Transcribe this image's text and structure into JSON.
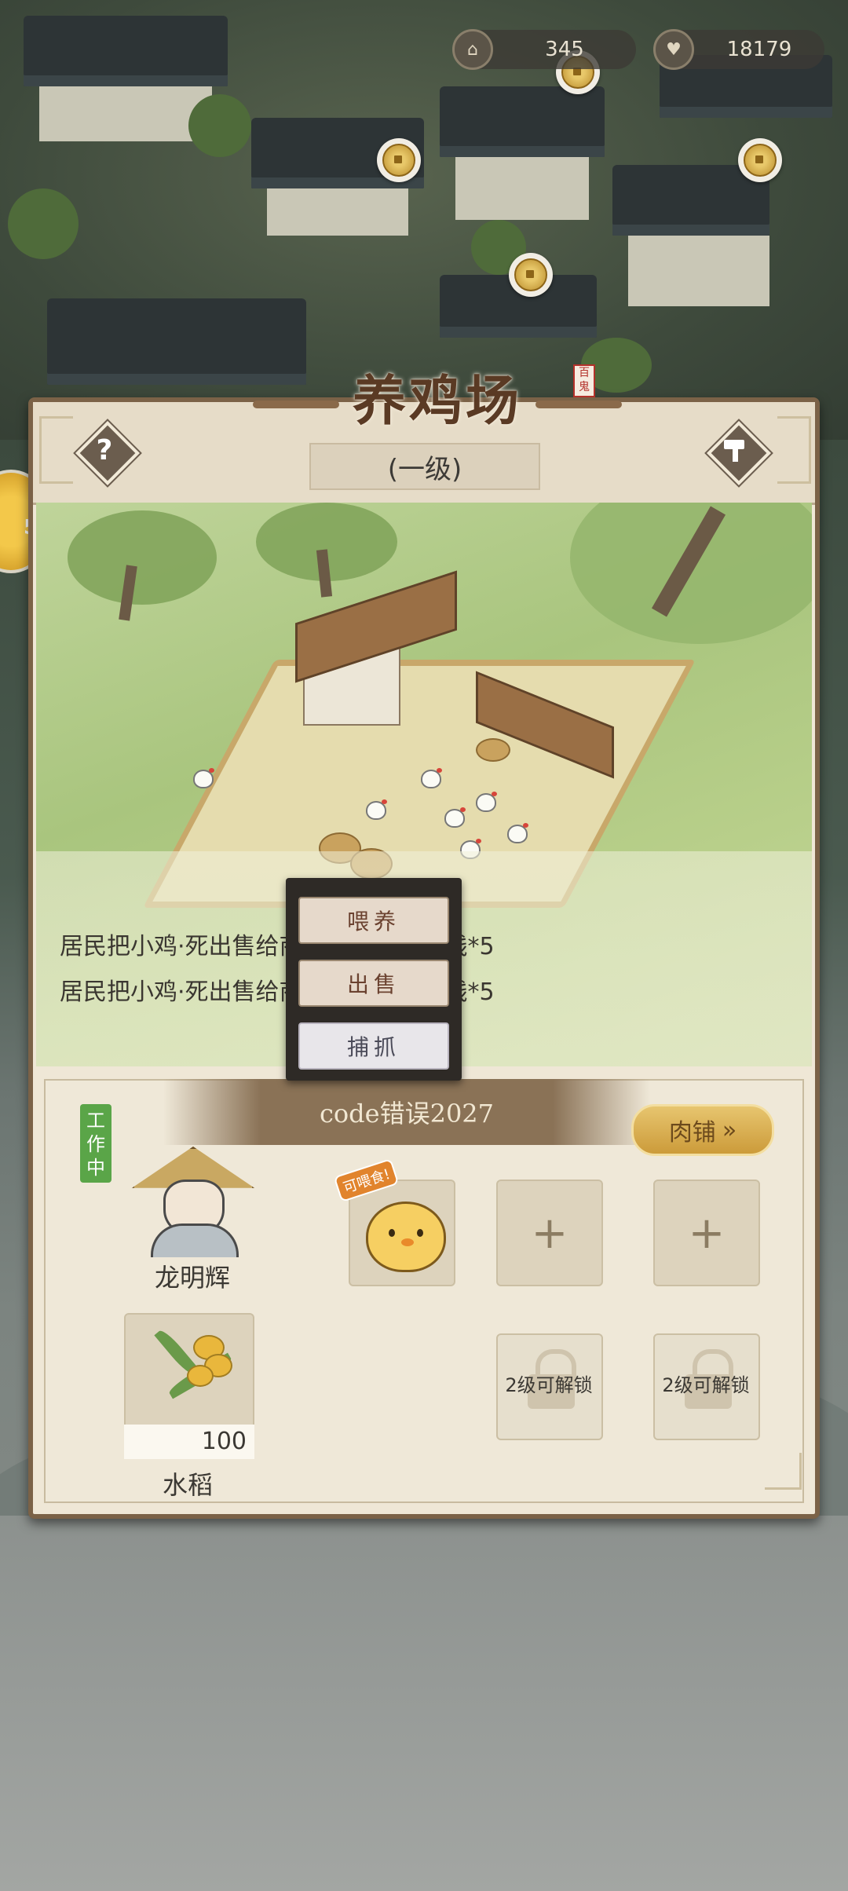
{
  "resources": {
    "population": {
      "icon": "house-icon",
      "value": "345"
    },
    "happiness": {
      "icon": "heart-icon",
      "value": "18179"
    }
  },
  "building": {
    "title": "养鸡场",
    "seal": "百鬼",
    "level": "(一级)",
    "help_icon": "?",
    "upgrade_icon": "hammer-icon"
  },
  "log": {
    "lines": [
      "居民把小鸡·死出售给商人，获得了铜钱*5",
      "居民把小鸡·死出售给商人，获得了铜钱*5"
    ]
  },
  "work": {
    "title": "code错误2027",
    "meat_shop_label": "肉铺",
    "worker_status": "工作中",
    "worker_name": "龙明辉",
    "resource_name": "水稻",
    "resource_count": "100",
    "chick_tag": "可喂食!",
    "add_slot": "+",
    "locked_slot_1": "2级可解锁",
    "locked_slot_2": "2级可解锁"
  },
  "actions": {
    "feed": "喂养",
    "sell": "出售",
    "catch": "捕抓"
  }
}
